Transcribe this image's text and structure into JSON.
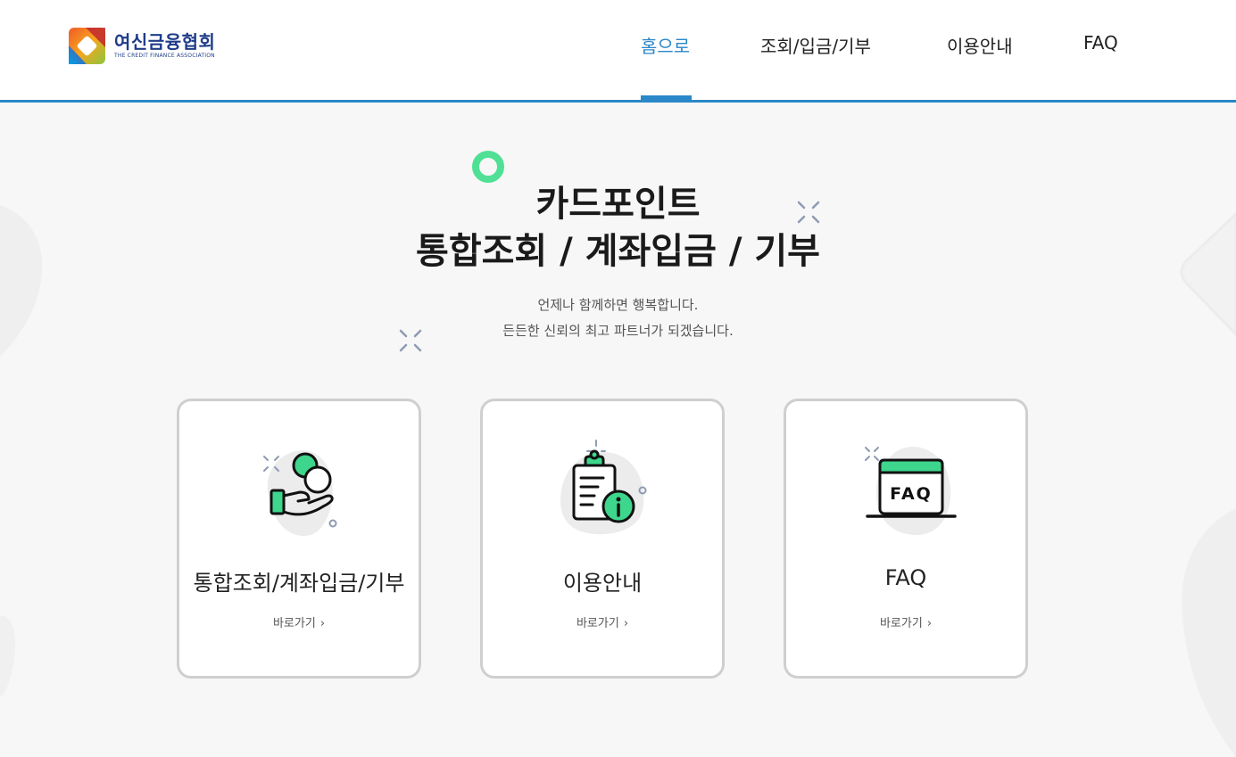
{
  "header": {
    "logo": {
      "name": "여신금융협회",
      "subtitle": "THE CREDIT FINANCE ASSOCIATION",
      "icon": "credit-finance-logo-icon"
    },
    "nav": [
      {
        "label": "홈으로",
        "active": true
      },
      {
        "label": "조회/입금/기부",
        "active": false
      },
      {
        "label": "이용안내",
        "active": false
      },
      {
        "label": "FAQ",
        "active": false
      }
    ]
  },
  "hero": {
    "title_line1": "카드포인트",
    "title_line2": "통합조회 / 계좌입금 / 기부",
    "subtitle_line1": "언제나 함께하면 행복합니다.",
    "subtitle_line2": "든든한 신뢰의 최고 파트너가 되겠습니다."
  },
  "cards": [
    {
      "title": "통합조회/계좌입금/기부",
      "link": "바로가기",
      "icon": "coin-in-hand-icon"
    },
    {
      "title": "이용안내",
      "link": "바로가기",
      "icon": "clipboard-info-icon"
    },
    {
      "title": "FAQ",
      "link": "바로가기",
      "icon": "faq-window-icon"
    }
  ],
  "colors": {
    "accent": "#2a87c8",
    "green": "#3dd68c",
    "logo_text": "#1f3c8a",
    "card_border": "#cfcfcf"
  }
}
